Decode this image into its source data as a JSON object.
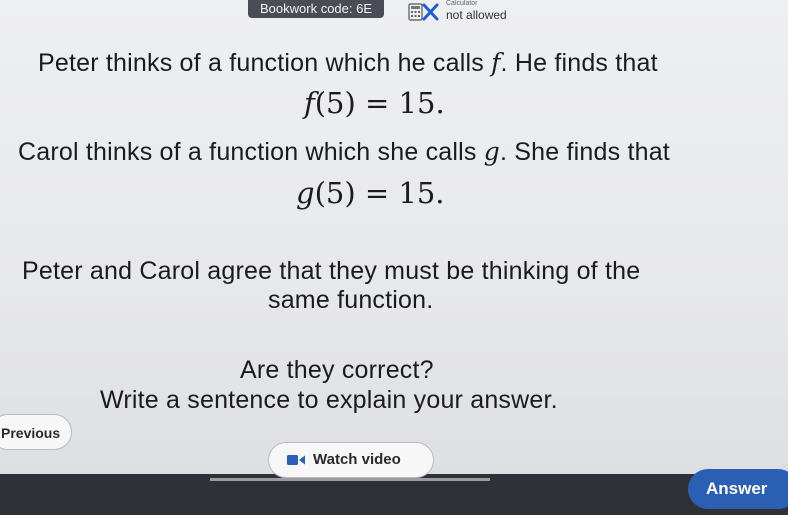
{
  "header": {
    "bookwork_code": "Bookwork code: 6E",
    "calculator_caption": "Calculator",
    "calculator_status": "not allowed"
  },
  "question": {
    "line1": "Peter thinks of a function which he calls ",
    "line1_fn": "f",
    "line1_end": ". He finds that",
    "eq1_fn": "f",
    "eq1_rest": "(5) = 15.",
    "line2": "Carol thinks of a function which she calls ",
    "line2_fn": "g",
    "line2_end": ". She finds that",
    "eq2_fn": "g",
    "eq2_rest": "(5) = 15.",
    "line3": "Peter and Carol agree that they must be thinking of the",
    "line4": "same function.",
    "line5": "Are they correct?",
    "line6": "Write a sentence to explain your answer."
  },
  "controls": {
    "previous_label": "Previous",
    "watch_video_label": "Watch video",
    "answer_label": "Answer"
  },
  "icons": {
    "calculator": "calculator-crossed-icon",
    "video": "video-camera-icon"
  },
  "colors": {
    "answer_button": "#2b5fb4",
    "calc_cross": "#1f5fd6",
    "badge": "#4a4d55"
  }
}
